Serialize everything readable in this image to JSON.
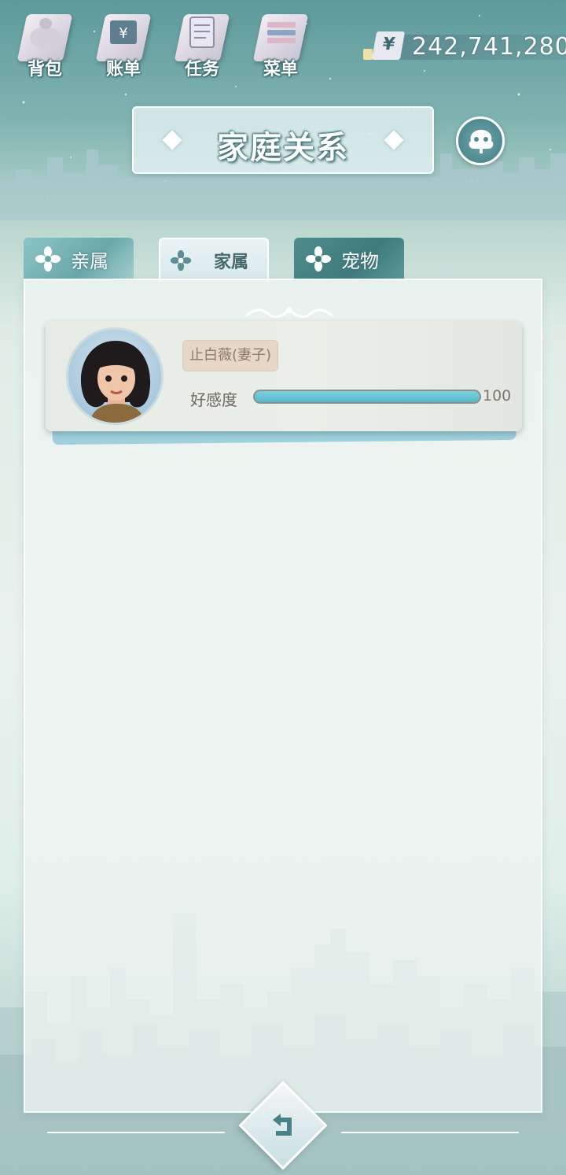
{
  "toolbar": {
    "items": [
      {
        "label": "背包",
        "icon": "bag-icon"
      },
      {
        "label": "账单",
        "icon": "bill-icon"
      },
      {
        "label": "任务",
        "icon": "task-icon"
      },
      {
        "label": "菜单",
        "icon": "menu-icon"
      }
    ]
  },
  "currency": {
    "symbol": "¥",
    "amount": "242,741,280"
  },
  "page": {
    "title": "家庭关系",
    "family_icon": "family-tree-icon"
  },
  "tabs": [
    {
      "label": "亲属",
      "icon": "flower-icon",
      "active": false
    },
    {
      "label": "家属",
      "icon": "flower-icon",
      "active": true
    },
    {
      "label": "宠物",
      "icon": "flower-icon",
      "active": false
    }
  ],
  "members": [
    {
      "name": "止白薇(妻子)",
      "favor_label": "好感度",
      "favor_value": "100",
      "favor_fraction": 1.0
    }
  ],
  "colors": {
    "accent": "#55b8c9",
    "title_stroke": "#3f6e74",
    "active_tab": "#eaf3f4"
  },
  "back_icon": "return-arrow-icon"
}
